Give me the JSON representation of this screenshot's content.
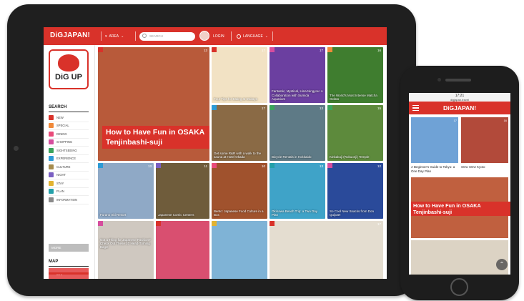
{
  "site": {
    "logo": "DiGJAPAN!",
    "area_label": "AREA",
    "search_placeholder": "SEARCH",
    "login_label": "LOGIN",
    "language_label": "LANGUAGE"
  },
  "sidebar": {
    "badge_text": "DiG UP",
    "search_heading": "SEARCH",
    "categories": [
      "NEW",
      "SPECIAL",
      "DINING",
      "SHOPPING",
      "SIGHTSEEING",
      "EXPERIENCE",
      "CULTURE",
      "NIGHT",
      "STAY",
      "PLAN",
      "INFORMATION"
    ],
    "category_colors": [
      "#d9322a",
      "#f0893a",
      "#e94b7a",
      "#d64d9e",
      "#3aa35c",
      "#2c9bd6",
      "#a58b4d",
      "#7a5fc2",
      "#e2b331",
      "#23a0a9",
      "#8a8a8a"
    ],
    "more_label": "MORE",
    "map_heading": "MAP",
    "map_button": "MAP"
  },
  "tiles": [
    {
      "caption": "How to Have Fun in OSAKA Tenjinbashi-suji",
      "likes": "13",
      "color": "#b85a3a"
    },
    {
      "caption": "Four Tips for Eating at Izakaya",
      "likes": "17",
      "color": "#f2e2c4"
    },
    {
      "caption": "Fantastic, Mystical, Hina Ningyou: A Collaboration with Sumida Aquarium",
      "likes": "17",
      "color": "#6b3fa0"
    },
    {
      "caption": "The World's Most Intense Matcha Gelato",
      "likes": "16",
      "color": "#3f7d2f"
    },
    {
      "caption": "Get some R&R with a walk to the sauna at Hotel Okada",
      "likes": "17",
      "color": "#8a6a45"
    },
    {
      "caption": "Bicycle Rentals in Hokkaido",
      "likes": "13",
      "color": "#5e7a86"
    },
    {
      "caption": "Kinkakuji (Rokuonji) Temple",
      "likes": "15",
      "color": "#5d8a3c"
    },
    {
      "caption": "Furano Ski Resort",
      "likes": "13",
      "color": "#8fa9c6"
    },
    {
      "caption": "Japanese Comic Centers",
      "likes": "11",
      "color": "#6f5c3b"
    },
    {
      "caption": "Bento: Japanese Food Culture in a Box",
      "likes": "10",
      "color": "#a0522d"
    },
    {
      "caption": "Okinawa Beach Trip: a Two Day Plan",
      "likes": "13",
      "color": "#3fa3c8"
    },
    {
      "caption": "So Cool New Snacks from Don Quijote!",
      "likes": "12",
      "color": "#2a4a9a"
    },
    {
      "caption": "Got a Thing for Japanese Fashion? Check Out These 10 Head-Turning Bags!",
      "likes": "",
      "color": "#cfc8c0"
    },
    {
      "caption": "",
      "likes": "",
      "color": "#d94f70"
    },
    {
      "caption": "",
      "likes": "",
      "color": "#7fb3d6"
    },
    {
      "caption": "",
      "likes": "17",
      "color": "#e4ddd0"
    }
  ],
  "phone": {
    "time": "17:21",
    "url": "digjapan.travel",
    "logo": "DiGJAPAN!",
    "card1_caption": "A Beginner's Guide to Tokyo: a One Day Plan",
    "card1_likes": "17",
    "card2_caption": "SOU SOU Kyoto",
    "card2_likes": "16",
    "feature_caption": "How to Have Fun in OSAKA Tenjinbashi-suji"
  }
}
